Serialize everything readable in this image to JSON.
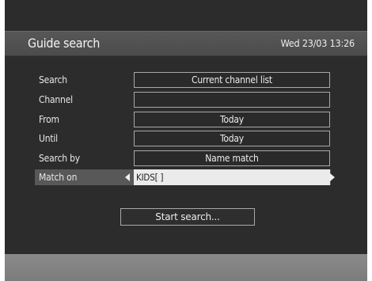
{
  "header": {
    "title": "Guide search",
    "datetime": "Wed 23/03 13:26"
  },
  "form": {
    "rows": [
      {
        "label": "Search",
        "value": "Current channel list"
      },
      {
        "label": "Channel",
        "value": ""
      },
      {
        "label": "From",
        "value": "Today"
      },
      {
        "label": "Until",
        "value": "Today"
      },
      {
        "label": "Search by",
        "value": "Name match"
      },
      {
        "label": "Match on",
        "value": "KIDS[ ]"
      }
    ]
  },
  "actions": {
    "start_label": "Start search..."
  },
  "colors": {
    "background": "#2c2c2c",
    "header": "#505050",
    "active_row": "#585858",
    "active_field": "#ebebeb",
    "footer": "#848484"
  }
}
